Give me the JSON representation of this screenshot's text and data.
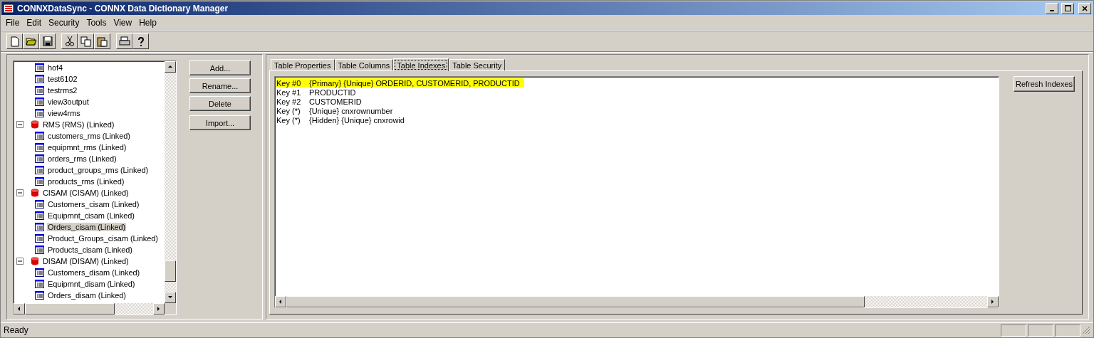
{
  "window": {
    "title": "CONNXDataSync - CONNX Data Dictionary Manager"
  },
  "menu": [
    "File",
    "Edit",
    "Security",
    "Tools",
    "View",
    "Help"
  ],
  "toolbar": [
    {
      "kind": "new"
    },
    {
      "kind": "open"
    },
    {
      "kind": "save"
    },
    {
      "kind": "sep"
    },
    {
      "kind": "cut"
    },
    {
      "kind": "copy"
    },
    {
      "kind": "paste"
    },
    {
      "kind": "sep"
    },
    {
      "kind": "print"
    },
    {
      "kind": "help"
    }
  ],
  "tree": [
    {
      "children": [
        {
          "label": "hof4",
          "selected": false
        },
        {
          "label": "test6102",
          "selected": false
        },
        {
          "label": "testrms2",
          "selected": false
        },
        {
          "label": "view3output",
          "selected": false
        },
        {
          "label": "view4rms",
          "selected": false
        }
      ]
    },
    {
      "label": "RMS (RMS) (Linked)",
      "expanded": true,
      "children": [
        {
          "label": "customers_rms (Linked)",
          "selected": false
        },
        {
          "label": "equipmnt_rms (Linked)",
          "selected": false
        },
        {
          "label": "orders_rms (Linked)",
          "selected": false
        },
        {
          "label": "product_groups_rms (Linked)",
          "selected": false
        },
        {
          "label": "products_rms (Linked)",
          "selected": false
        }
      ]
    },
    {
      "label": "CISAM (CISAM) (Linked)",
      "expanded": true,
      "children": [
        {
          "label": "Customers_cisam (Linked)",
          "selected": false
        },
        {
          "label": "Equipmnt_cisam (Linked)",
          "selected": false
        },
        {
          "label": "Orders_cisam (Linked)",
          "selected": true
        },
        {
          "label": "Product_Groups_cisam (Linked)",
          "selected": false
        },
        {
          "label": "Products_cisam (Linked)",
          "selected": false
        }
      ]
    },
    {
      "label": "DISAM (DISAM) (Linked)",
      "expanded": true,
      "children": [
        {
          "label": "Customers_disam (Linked)",
          "selected": false
        },
        {
          "label": "Equipmnt_disam (Linked)",
          "selected": false
        },
        {
          "label": "Orders_disam (Linked)",
          "selected": false
        }
      ]
    }
  ],
  "side_buttons": [
    "Add...",
    "Rename...",
    "Delete",
    "Import..."
  ],
  "tabs": [
    {
      "label": "Table Properties",
      "selected": false
    },
    {
      "label": "Table Columns",
      "selected": false
    },
    {
      "label": "Table Indexes",
      "selected": true
    },
    {
      "label": "Table Security",
      "selected": false
    }
  ],
  "indexes": [
    {
      "key": "Key #0",
      "definition": "{Primary} {Unique} ORDERID, CUSTOMERID, PRODUCTID",
      "selected": true
    },
    {
      "key": "Key #1",
      "definition": "PRODUCTID",
      "selected": false
    },
    {
      "key": "Key #2",
      "definition": "CUSTOMERID",
      "selected": false
    },
    {
      "key": "Key (*)",
      "definition": "{Unique} cnxrownumber",
      "selected": false
    },
    {
      "key": "Key (*)",
      "definition": "{Hidden} {Unique} cnxrowid",
      "selected": false
    }
  ],
  "refresh_button": "Refresh Indexes",
  "status_bar": {
    "text": "Ready"
  }
}
